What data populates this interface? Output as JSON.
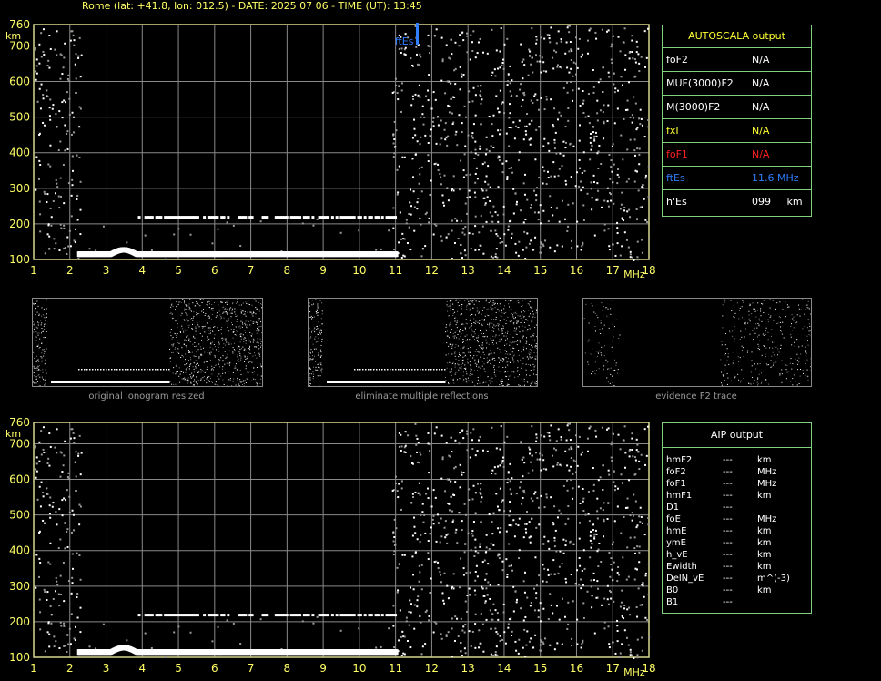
{
  "header": "Rome (lat: +41.8, lon: 012.5) - DATE: 2025 07 06 - TIME (UT): 13:45",
  "colors": {
    "grid": "#8a8a8a",
    "axis": "#ffff66",
    "frame": "#d8d890",
    "box_border": "#7fd07f",
    "yellow": "#ffff33",
    "red": "#ff2020",
    "blue": "#2f7fff"
  },
  "autoscala": {
    "title": "AUTOSCALA output",
    "rows": [
      {
        "label": "foF2",
        "value": "N/A",
        "color": "#ffffff"
      },
      {
        "label": "MUF(3000)F2",
        "value": "N/A",
        "color": "#ffffff"
      },
      {
        "label": "M(3000)F2",
        "value": "N/A",
        "color": "#ffffff"
      },
      {
        "label": "fxI",
        "value": "N/A",
        "color": "#ffff33"
      },
      {
        "label": "foF1",
        "value": "N/A",
        "color": "#ff2020"
      },
      {
        "label": "ftEs",
        "value": "11.6 MHz",
        "color": "#2f7fff"
      },
      {
        "label": "h'Es",
        "value": "099     km",
        "color": "#ffffff"
      }
    ]
  },
  "aip": {
    "title": "AIP output",
    "rows": [
      {
        "label": "hmF2",
        "value": "---",
        "unit": "km"
      },
      {
        "label": "foF2",
        "value": "---",
        "unit": "MHz"
      },
      {
        "label": "foF1",
        "value": "---",
        "unit": "MHz"
      },
      {
        "label": "hmF1",
        "value": "---",
        "unit": "km"
      },
      {
        "label": "D1",
        "value": "---",
        "unit": ""
      },
      {
        "label": "foE",
        "value": "---",
        "unit": "MHz"
      },
      {
        "label": "hmE",
        "value": "---",
        "unit": "km"
      },
      {
        "label": "ymE",
        "value": "---",
        "unit": "km"
      },
      {
        "label": "h_vE",
        "value": "---",
        "unit": "km"
      },
      {
        "label": "Ewidth",
        "value": "---",
        "unit": "km"
      },
      {
        "label": "DelN_vE",
        "value": "---",
        "unit": "m^(-3)"
      },
      {
        "label": "B0",
        "value": "---",
        "unit": "km"
      },
      {
        "label": "B1",
        "value": "---",
        "unit": ""
      }
    ]
  },
  "thumbnails": [
    {
      "caption": "original ionogram resized"
    },
    {
      "caption": "eliminate multiple reflections"
    },
    {
      "caption": "evidence F2 trace"
    }
  ],
  "chart_data": [
    {
      "type": "scatter",
      "name": "ionogram-top",
      "xlabel": "MHz",
      "ylabel": "km",
      "xlim": [
        1,
        18
      ],
      "ylim": [
        100,
        760
      ],
      "x_ticks": [
        1,
        2,
        3,
        4,
        5,
        6,
        7,
        8,
        9,
        10,
        11,
        12,
        13,
        14,
        15,
        16,
        17,
        18
      ],
      "y_ticks": [
        100,
        200,
        300,
        400,
        500,
        600,
        700,
        760
      ],
      "grid": true,
      "annotations": [
        {
          "label": "ftEs",
          "x": 11.6
        }
      ],
      "traces": [
        {
          "name": "Es trace",
          "x_start": 2.2,
          "x_end": 11.0,
          "height_km": 115
        },
        {
          "name": "Es 2nd hop",
          "x_start": 3.7,
          "x_end": 11.0,
          "height_km": 220
        }
      ],
      "noise_band_start_mhz": 10.9
    },
    {
      "type": "scatter",
      "name": "ionogram-bottom",
      "xlabel": "MHz",
      "ylabel": "km",
      "xlim": [
        1,
        18
      ],
      "ylim": [
        100,
        760
      ],
      "x_ticks": [
        1,
        2,
        3,
        4,
        5,
        6,
        7,
        8,
        9,
        10,
        11,
        12,
        13,
        14,
        15,
        16,
        17,
        18
      ],
      "y_ticks": [
        100,
        200,
        300,
        400,
        500,
        600,
        700,
        760
      ],
      "grid": true,
      "traces": [
        {
          "name": "Es trace",
          "x_start": 2.2,
          "x_end": 11.0,
          "height_km": 115
        },
        {
          "name": "Es 2nd hop",
          "x_start": 3.7,
          "x_end": 11.0,
          "height_km": 220
        }
      ],
      "noise_band_start_mhz": 10.9
    }
  ]
}
